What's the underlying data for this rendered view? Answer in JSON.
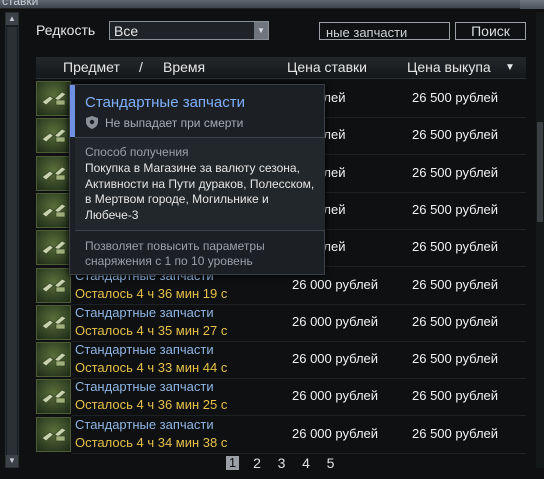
{
  "window": {
    "title": "ставки"
  },
  "filter": {
    "rarity_label": "Редкость",
    "rarity_value": "Все",
    "search_value": "ные запчасти",
    "search_button": "Поиск"
  },
  "table": {
    "headers": {
      "item": "Предмет",
      "slash": "/",
      "time": "Время",
      "bid": "Цена ставки",
      "buyout": "Цена выкупа"
    },
    "sort_indicator": "▼",
    "rows": [
      {
        "bid": "0 рублей",
        "buyout": "26 500 рублей"
      },
      {
        "bid": "0 рублей",
        "buyout": "26 500 рублей"
      },
      {
        "bid": "0 рублей",
        "buyout": "26 500 рублей"
      },
      {
        "bid": "0 рублей",
        "buyout": "26 500 рублей"
      },
      {
        "bid": "0 рублей",
        "buyout": "26 500 рублей"
      },
      {
        "name": "Стандартные запчасти",
        "time": "Осталось 4 ч 36 мин 19 с",
        "bid": "26 000 рублей",
        "buyout": "26 500 рублей"
      },
      {
        "name": "Стандартные запчасти",
        "time": "Осталось 4 ч 35 мин 27 с",
        "bid": "26 000 рублей",
        "buyout": "26 500 рублей"
      },
      {
        "name": "Стандартные запчасти",
        "time": "Осталось 4 ч 33 мин 44 с",
        "bid": "26 000 рублей",
        "buyout": "26 500 рублей"
      },
      {
        "name": "Стандартные запчасти",
        "time": "Осталось 4 ч 36 мин 25 с",
        "bid": "26 000 рублей",
        "buyout": "26 500 рублей"
      },
      {
        "name": "Стандартные запчасти",
        "time": "Осталось 4 ч 34 мин 38 с",
        "bid": "26 000 рублей",
        "buyout": "26 500 рублей"
      }
    ]
  },
  "pagination": {
    "pages": [
      "1",
      "2",
      "3",
      "4",
      "5"
    ],
    "current": "1"
  },
  "tooltip": {
    "title": "Стандартные запчасти",
    "no_drop": "Не выпадает при смерти",
    "obtain_header": "Способ получения",
    "obtain_text": "Покупка в Магазине за валюту сезона, Активности на Пути дураков, Полесском, в Мертвом городе, Могильнике и Любече-3",
    "description": "Позволяет повысить параметры снаряжения с 1 по 10 уровень"
  },
  "colors": {
    "item_name": "#8fb6e6",
    "time_left": "#e7c14a",
    "tooltip_accent": "#6f8fe0"
  }
}
